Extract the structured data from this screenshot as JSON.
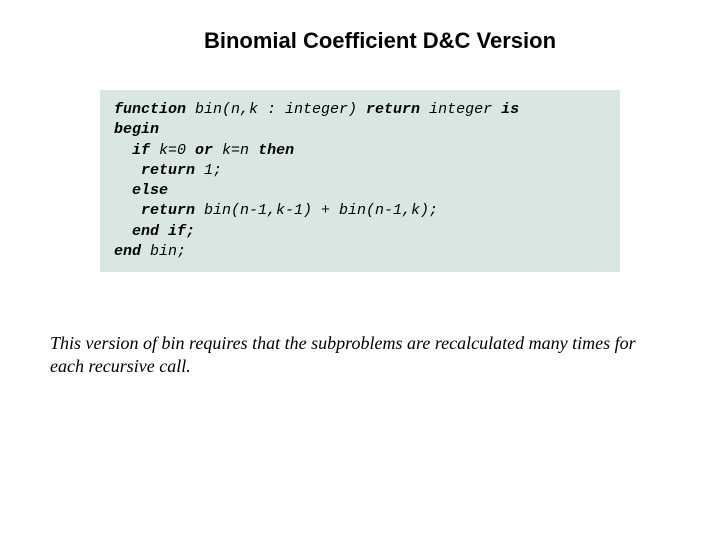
{
  "title": "Binomial Coefficient D&C Version",
  "code": {
    "l1a": "function",
    "l1b": " bin(n,k : integer) ",
    "l1c": "return",
    "l1d": " integer ",
    "l1e": "is",
    "l2": "begin",
    "l3a": "  if",
    "l3b": " k=0 ",
    "l3c": "or",
    "l3d": " k=n ",
    "l3e": "then",
    "l4a": "   return",
    "l4b": " 1;",
    "l5a": "  else",
    "l6a": "   return",
    "l6b": " bin(n-1,k-1) + bin(n-1,k);",
    "l7a": "  end if;",
    "l8a": "end",
    "l8b": " bin;"
  },
  "caption": "This version of bin requires that the subproblems are recalculated many times for each recursive call."
}
